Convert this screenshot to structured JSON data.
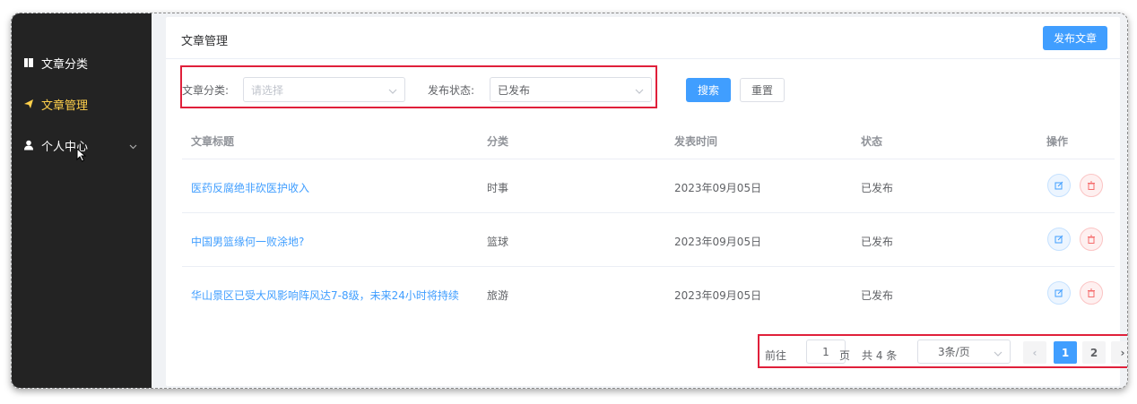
{
  "sidebar": {
    "items": [
      {
        "label": "文章分类",
        "icon": "book-icon"
      },
      {
        "label": "文章管理",
        "icon": "paper-plane-icon",
        "active": true
      },
      {
        "label": "个人中心",
        "icon": "user-icon",
        "has_submenu": true
      }
    ],
    "active_color": "#ffd04b"
  },
  "header": {
    "title": "文章管理",
    "publish_button": "发布文章"
  },
  "filters": {
    "category_label": "文章分类:",
    "category_placeholder": "请选择",
    "status_label": "发布状态:",
    "status_value": "已发布",
    "search_button": "搜索",
    "reset_button": "重置"
  },
  "table": {
    "columns": [
      "文章标题",
      "分类",
      "发表时间",
      "状态",
      "操作"
    ],
    "rows": [
      {
        "title": "医药反腐绝非砍医护收入",
        "category": "时事",
        "date": "2023年09月05日",
        "status": "已发布"
      },
      {
        "title": "中国男篮缘何一败涂地?",
        "category": "篮球",
        "date": "2023年09月05日",
        "status": "已发布"
      },
      {
        "title": "华山景区已受大风影响阵风达7-8级，未来24小时将持续",
        "category": "旅游",
        "date": "2023年09月05日",
        "status": "已发布"
      }
    ]
  },
  "pagination": {
    "goto_prefix": "前往",
    "goto_value": "1",
    "goto_suffix": "页",
    "total": "共 4 条",
    "page_size": "3条/页",
    "prev": "‹",
    "pages": [
      "1",
      "2"
    ],
    "current": "1",
    "next": "›"
  },
  "colors": {
    "primary": "#409eff",
    "danger": "#f56c6c",
    "highlight_box": "#e0203a"
  }
}
